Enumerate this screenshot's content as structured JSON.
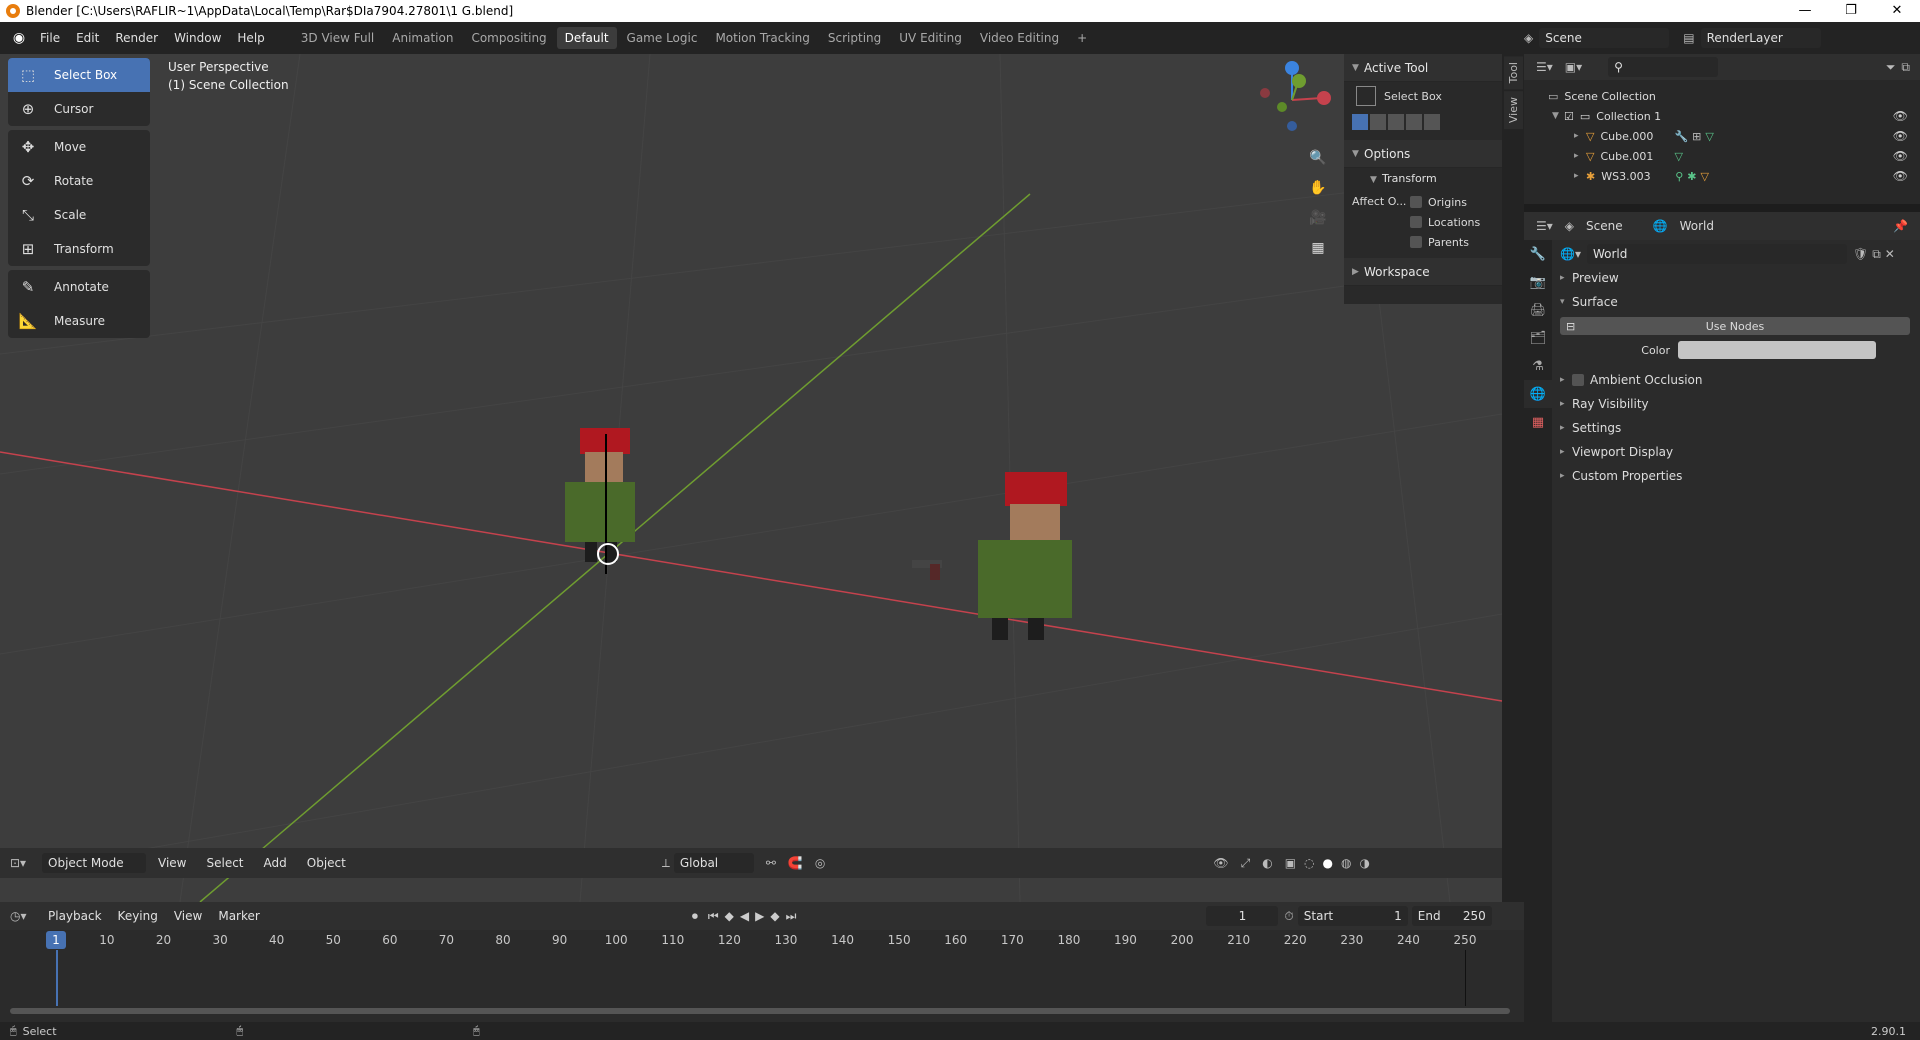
{
  "window": {
    "title": "Blender [C:\\Users\\RAFLIR~1\\AppData\\Local\\Temp\\Rar$DIa7904.27801\\1 G.blend]",
    "minimize": "—",
    "maximize": "❐",
    "close": "✕"
  },
  "menu": [
    "File",
    "Edit",
    "Render",
    "Window",
    "Help"
  ],
  "workspaces": [
    "3D View Full",
    "Animation",
    "Compositing",
    "Default",
    "Game Logic",
    "Motion Tracking",
    "Scripting",
    "UV Editing",
    "Video Editing"
  ],
  "active_workspace": "Default",
  "scene": {
    "label": "Scene",
    "render_layer": "RenderLayer"
  },
  "toolbar": {
    "tools": [
      {
        "label": "Select Box",
        "icon": "select-box-icon",
        "active": true
      },
      {
        "label": "Cursor",
        "icon": "cursor-icon"
      },
      {
        "label": "Move",
        "icon": "move-icon"
      },
      {
        "label": "Rotate",
        "icon": "rotate-icon"
      },
      {
        "label": "Scale",
        "icon": "scale-icon"
      },
      {
        "label": "Transform",
        "icon": "transform-icon"
      },
      {
        "label": "Annotate",
        "icon": "annotate-icon"
      },
      {
        "label": "Measure",
        "icon": "measure-icon"
      }
    ]
  },
  "viewport": {
    "perspective": "User Perspective",
    "collection": "(1) Scene Collection"
  },
  "npanel": {
    "active_tool": "Active Tool",
    "tool_name": "Select Box",
    "options": "Options",
    "transform": "Transform",
    "affect": "Affect O...",
    "origins": "Origins",
    "locations": "Locations",
    "parents": "Parents",
    "workspace": "Workspace"
  },
  "vp_header": {
    "mode": "Object Mode",
    "view": "View",
    "select": "Select",
    "add": "Add",
    "object": "Object",
    "orientation": "Global"
  },
  "side_tabs": [
    "Tool",
    "View"
  ],
  "timeline": {
    "playback": "Playback",
    "keying": "Keying",
    "view": "View",
    "marker": "Marker",
    "current_frame": "1",
    "start_label": "Start",
    "start": "1",
    "end_label": "End",
    "end": "250",
    "ruler": [
      "1",
      "10",
      "20",
      "30",
      "40",
      "50",
      "60",
      "70",
      "80",
      "90",
      "100",
      "110",
      "120",
      "130",
      "140",
      "150",
      "160",
      "170",
      "180",
      "190",
      "200",
      "210",
      "220",
      "230",
      "240",
      "250"
    ]
  },
  "status": {
    "left": "Select",
    "version": "2.90.1"
  },
  "outliner": {
    "root": "Scene Collection",
    "collection": "Collection 1",
    "items": [
      "Cube.000",
      "Cube.001",
      "WS3.003"
    ]
  },
  "properties": {
    "scene_tab": "Scene",
    "world_tab": "World",
    "world_name": "World",
    "preview": "Preview",
    "surface": "Surface",
    "use_nodes": "Use Nodes",
    "color_label": "Color",
    "sections": [
      "Ambient Occlusion",
      "Ray Visibility",
      "Settings",
      "Viewport Display",
      "Custom Properties"
    ]
  },
  "colors": {
    "accent": "#4772b3",
    "x_axis": "#c5424d",
    "y_axis": "#6f9d30",
    "z_axis": "#3b84e0"
  }
}
